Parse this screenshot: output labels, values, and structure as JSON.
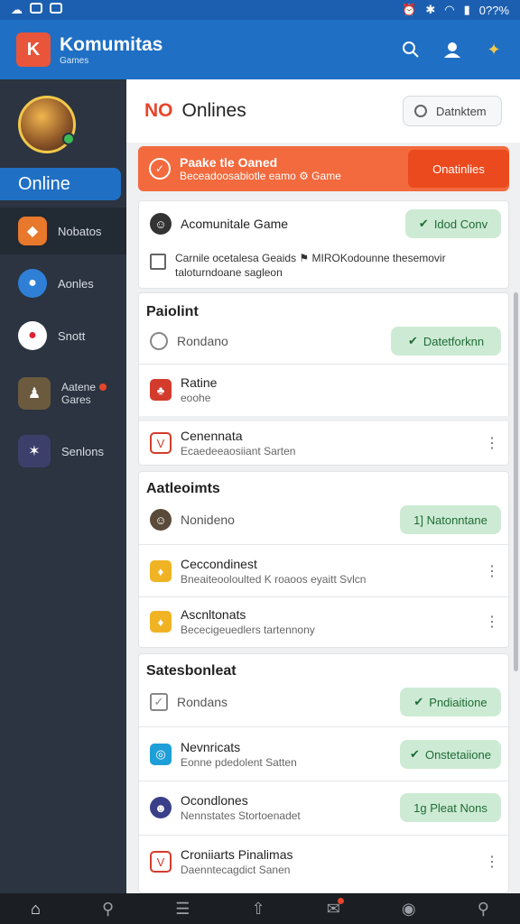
{
  "status_bar": {
    "right_text": "0??%"
  },
  "app": {
    "title": "Komumitas",
    "subtitle": "Games",
    "logo_letter": "K"
  },
  "sidebar": {
    "online_label": "Online",
    "items": [
      {
        "label": "Nobatos"
      },
      {
        "label": "Aonles"
      },
      {
        "label": "Snott"
      },
      {
        "label1": "Aatene",
        "label2": "Gares"
      },
      {
        "label": "Senlons"
      }
    ]
  },
  "main": {
    "header_no": "NO",
    "header_title": "Onlines",
    "status_button": "Datnktem",
    "banner": {
      "title": "Paake tle Oaned",
      "subtitle": "Beceadoosabiotle eamo ⚙ Game",
      "button": "Onatinlies"
    },
    "top_card": {
      "row1": {
        "title": "Acomunitale Game",
        "button": "Idod Conv"
      },
      "row2": {
        "line1": "Carnile ocetalesa Geaids  ⚑ MIROKodounne thesemovir",
        "line2": "taloturndoane sagleon"
      }
    },
    "section1": {
      "title": "Paiolint",
      "placeholder": "Rondano",
      "button": "Datetforknn",
      "rows": [
        {
          "title": "Ratine",
          "subtitle": "eoohe"
        },
        {
          "title": "Cenennata",
          "subtitle": "Ecaedeeaosiiant Sarten"
        }
      ]
    },
    "section2": {
      "title": "Aatleoimts",
      "placeholder": "Nonideno",
      "button": "1] Natonntane",
      "rows": [
        {
          "title": "Ceccondinest",
          "subtitle": "Bneaiteooloulted K roaoos eyaitt Svlcn"
        },
        {
          "title": "Ascnltonats",
          "subtitle": "Bececigeuedlers tartennony"
        }
      ]
    },
    "section3": {
      "title": "Satesbonleat",
      "placeholder": "Rondans",
      "button": "Pndiaitione",
      "rows": [
        {
          "title": "Nevnricats",
          "subtitle": "Eonne pdedolent Satten",
          "button": "Onstetaiione"
        },
        {
          "title": "Ocondlones",
          "subtitle": "Nennstates Stortoenadet",
          "button": "1g Pleat Nons"
        },
        {
          "title": "Croniiarts Pinalimas",
          "subtitle": "Daenntecagdict Sanen"
        }
      ]
    }
  },
  "colors": {
    "accent": "#1f6fc4",
    "orange": "#f26a3d",
    "green_btn": "#cdebd4"
  }
}
